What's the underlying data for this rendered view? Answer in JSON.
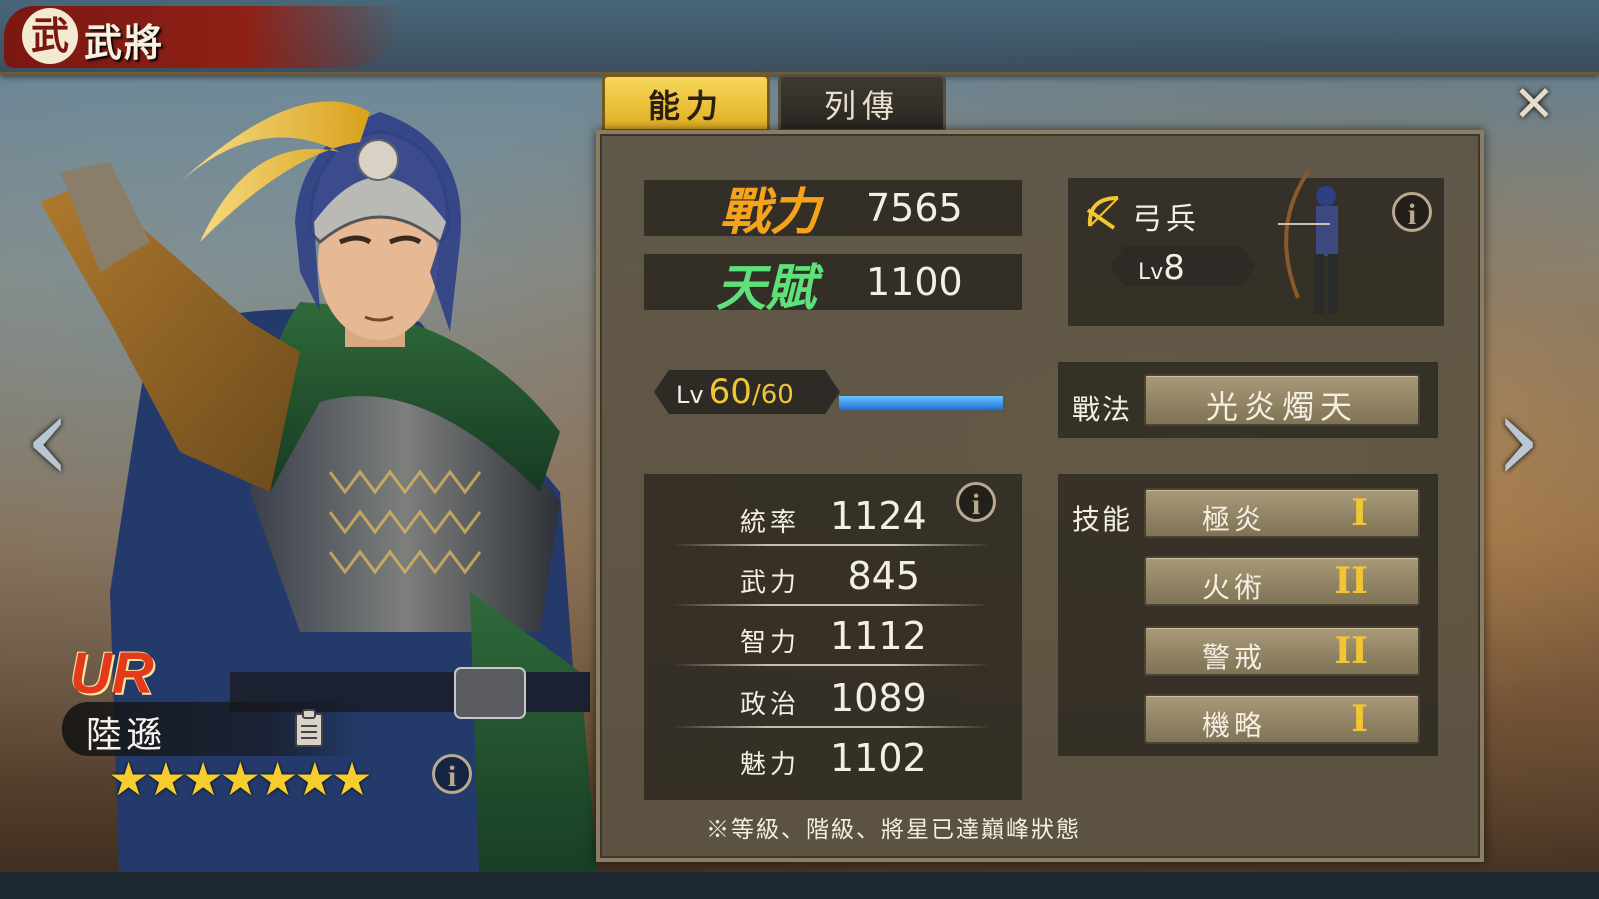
{
  "header": {
    "emblem": "武",
    "title": "武將"
  },
  "tabs": [
    {
      "label": "能力",
      "active": true
    },
    {
      "label": "列傳",
      "active": false
    }
  ],
  "hero": {
    "rarity": "UR",
    "name": "陸遜",
    "star_count": 7,
    "stars": "★★★★★★★"
  },
  "power": {
    "label": "戰力",
    "value": "7565",
    "label_color": "#f6a21b"
  },
  "talent": {
    "label": "天賦",
    "value": "1100",
    "label_color": "#5fe07a"
  },
  "troop": {
    "icon": "bow-icon",
    "type": "弓兵",
    "lv_prefix": "Lv",
    "lv_value": "8"
  },
  "level": {
    "prefix": "Lv",
    "current": "60",
    "separator": "/",
    "max": "60",
    "progress_fraction": 1.0
  },
  "tactic": {
    "label": "戰法",
    "name": "光炎燭天"
  },
  "skills": {
    "label": "技能",
    "items": [
      {
        "name": "極炎",
        "rank": "I"
      },
      {
        "name": "火術",
        "rank": "II"
      },
      {
        "name": "警戒",
        "rank": "II"
      },
      {
        "name": "機略",
        "rank": "I"
      }
    ]
  },
  "attributes": [
    {
      "label": "統率",
      "value": "1124"
    },
    {
      "label": "武力",
      "value": "845"
    },
    {
      "label": "智力",
      "value": "1112"
    },
    {
      "label": "政治",
      "value": "1089"
    },
    {
      "label": "魅力",
      "value": "1102"
    }
  ],
  "footnote": "※等級、階級、將星已達巔峰狀態",
  "info_glyph": "i",
  "nav": {
    "left": "‹",
    "right": "›",
    "close": "✕"
  },
  "colors": {
    "accent_gold": "#f2c533",
    "rarity_red": "#e33a1c",
    "panel": "#5c5444"
  }
}
